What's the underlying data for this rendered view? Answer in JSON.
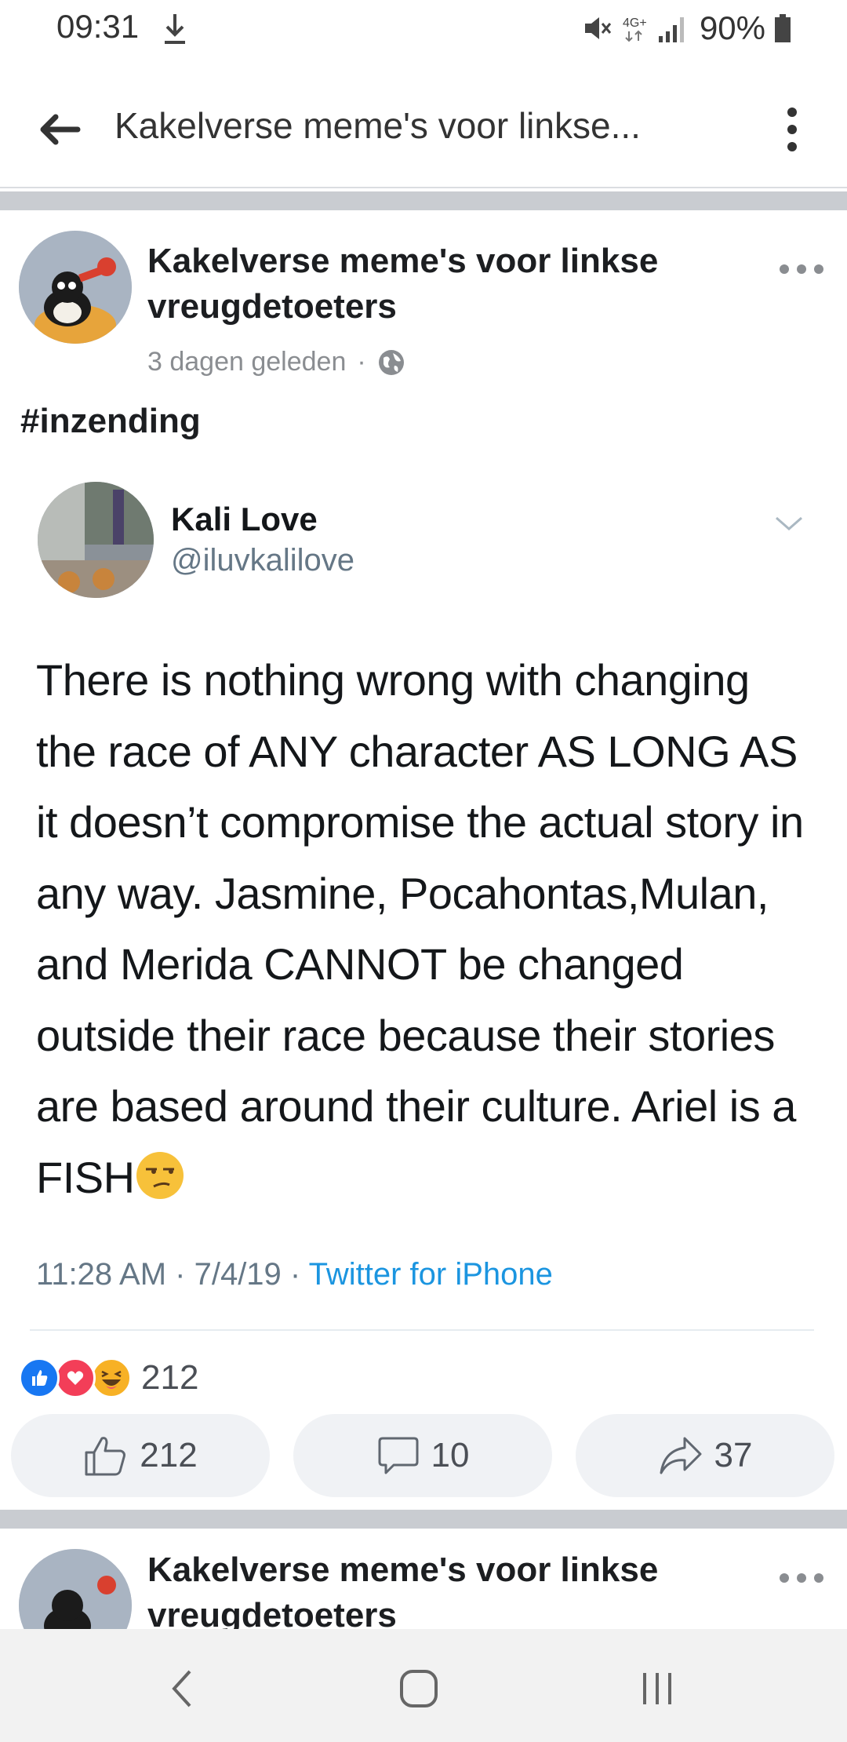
{
  "status_bar": {
    "time": "09:31",
    "network": "4G+",
    "battery": "90%"
  },
  "app_bar": {
    "title": "Kakelverse meme's voor linkse..."
  },
  "post": {
    "author": "Kakelverse meme's voor linkse vreugdetoeters",
    "timestamp": "3 dagen geleden",
    "separator": "·",
    "hashtag": "#inzending",
    "tweet": {
      "name": "Kali Love",
      "handle": "@iluvkalilove",
      "text": "There is nothing wrong with changing the race of ANY character AS LONG AS it doesn’t compromise the actual story in any way. Jasmine, Pocahontas,Mulan, and Merida CANNOT be changed outside their race because their stories are based around their culture.  Ariel is a FISH",
      "time": "11:28 AM · 7/4/19 · ",
      "source": "Twitter for iPhone"
    },
    "reaction_count": "212",
    "actions": {
      "like_count": "212",
      "comment_count": "10",
      "share_count": "37"
    }
  },
  "next_post": {
    "author": "Kakelverse meme's voor linkse vreugdetoeters"
  },
  "colors": {
    "like_blue": "#1877f2",
    "love_red": "#f33e58",
    "haha_yellow": "#f7b125",
    "twitter_blue": "#1b95e0",
    "divider_gray": "#c9ccd1"
  },
  "icons": [
    "download-icon",
    "mute-icon",
    "signal-icon",
    "battery-icon",
    "back-arrow-icon",
    "more-vert-icon",
    "globe-icon",
    "chevron-down-icon",
    "unamused-emoji-icon",
    "like-reaction-icon",
    "love-reaction-icon",
    "haha-reaction-icon",
    "thumbs-up-icon",
    "comment-icon",
    "share-icon",
    "nav-back-icon",
    "nav-home-icon",
    "nav-recents-icon"
  ]
}
